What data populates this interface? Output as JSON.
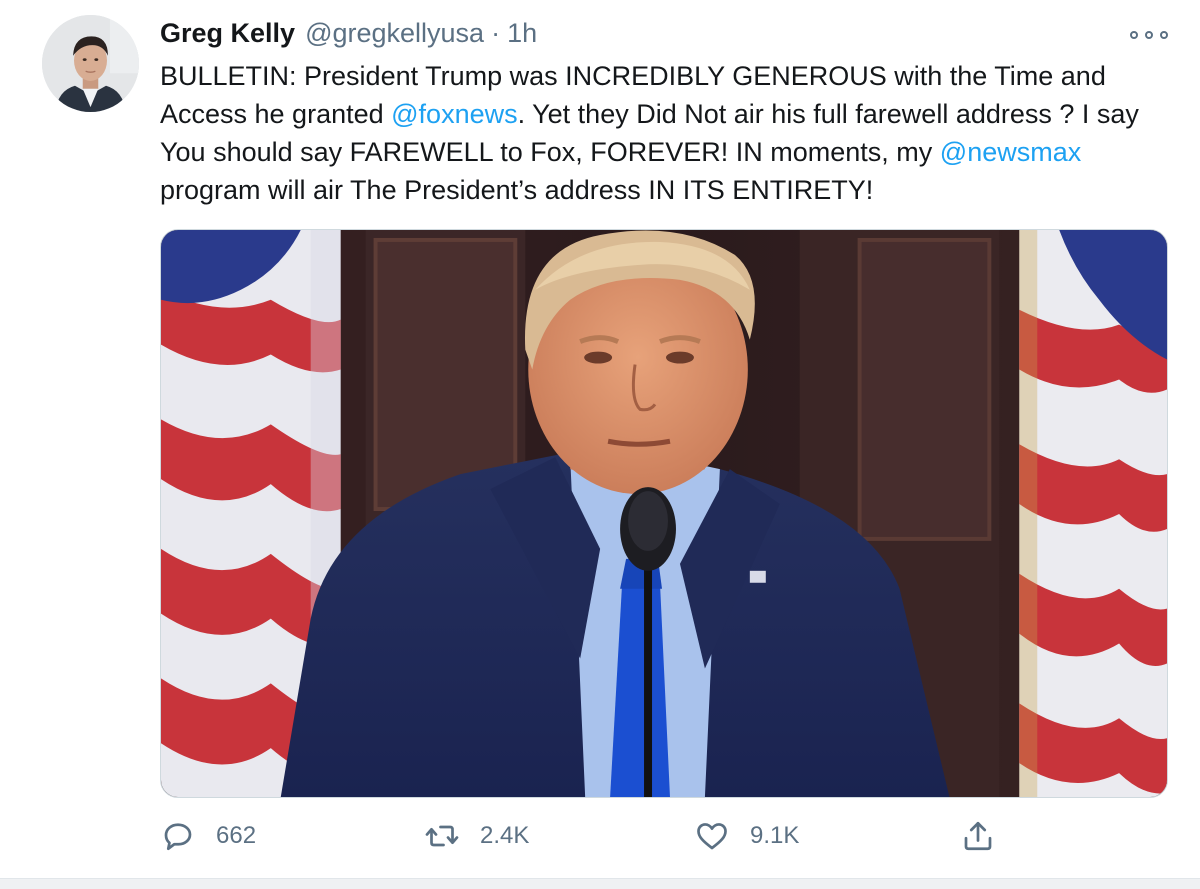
{
  "tweet": {
    "display_name": "Greg Kelly",
    "handle": "@gregkellyusa",
    "separator": "·",
    "time": "1h",
    "text": [
      {
        "type": "text",
        "value": "BULLETIN: President Trump was INCREDIBLY GENEROUS with the Time and Access he granted "
      },
      {
        "type": "mention",
        "value": "@foxnews"
      },
      {
        "type": "text",
        "value": ".  Yet they Did Not air his full farewell address ?  I say You should say FAREWELL to Fox, FOREVER! IN moments, my "
      },
      {
        "type": "mention",
        "value": "@newsmax"
      },
      {
        "type": "text",
        "value": " program will air The President’s address IN ITS ENTIRETY!"
      }
    ]
  },
  "actions": {
    "reply_icon": "speech-bubble-icon",
    "reply_count": "662",
    "retweet_icon": "retweet-arrows-icon",
    "retweet_count": "2.4K",
    "like_icon": "heart-icon",
    "like_count": "9.1K",
    "share_icon": "share-upload-icon"
  },
  "colors": {
    "link": "#1da1f2",
    "secondary_text": "#5b7083",
    "primary_text": "#14171a"
  }
}
